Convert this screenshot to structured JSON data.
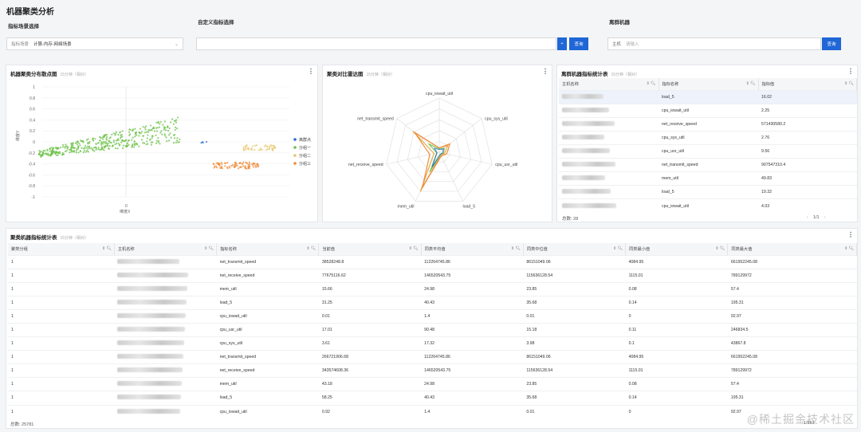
{
  "page": {
    "title": "机器聚类分析",
    "scene_label": "指标场景选择",
    "custom_label": "自定义指标选择",
    "discrete_label": "离群机器"
  },
  "scene_select": {
    "key": "指标场景",
    "value": "计算-内存-网络场景"
  },
  "custom": {
    "plus": "+",
    "query": "查询"
  },
  "host_filter": {
    "key": "主机",
    "placeholder": "请输入",
    "query": "查询"
  },
  "scatter": {
    "title": "机器聚类分布散点图",
    "sub": "15分钟（相对）",
    "ylabel": "维度Y",
    "xlabel": "维度X",
    "yticks": [
      "1",
      "0.8",
      "0.6",
      "0.4",
      "0.2",
      "0",
      "-0.2",
      "-0.4",
      "-0.6",
      "-0.8",
      "-1"
    ],
    "xtick": "0",
    "legend": [
      {
        "name": "离群点",
        "color": "#2c6bd0"
      },
      {
        "name": "分组一",
        "color": "#6dc24a"
      },
      {
        "name": "分组二",
        "color": "#e8c56a"
      },
      {
        "name": "分组三",
        "color": "#ef8c3a"
      }
    ]
  },
  "chart_data": {
    "type": "radar",
    "title": "聚类对比雷达图",
    "indicators": [
      "cpu_iowait_util",
      "cpu_sys_util",
      "cpu_usr_util",
      "load_5",
      "mem_util",
      "net_receive_speed",
      "net_transmit_speed"
    ]
  },
  "radar": {
    "title": "聚类对比雷达图",
    "sub": "15分钟（相对）"
  },
  "outlier": {
    "title": "离群机器指标统计表",
    "sub": "15分钟（相对）",
    "headers": [
      "主机名称",
      "指标名称",
      "指标值"
    ],
    "rows": [
      [
        "load_5",
        "16.02"
      ],
      [
        "cpu_iowait_util",
        "2.25"
      ],
      [
        "net_receive_speed",
        "571430580.2"
      ],
      [
        "cpu_sys_util",
        "2.76"
      ],
      [
        "cpu_usr_util",
        "9.56"
      ],
      [
        "net_transmit_speed",
        "907547310.4"
      ],
      [
        "mem_util",
        "49.83"
      ],
      [
        "load_5",
        "19.32"
      ],
      [
        "cpu_iowait_util",
        "4.03"
      ]
    ],
    "total": "总数:  28",
    "page": "1/1"
  },
  "cluster": {
    "title": "聚类机器指标统计表",
    "sub": "15分钟（相对）",
    "headers": [
      "聚类分组",
      "主机名称",
      "指标名称",
      "当前值",
      "同类平均值",
      "同类中位值",
      "同类最小值",
      "同类最大值"
    ],
    "rows": [
      [
        "1",
        "net_transmit_speed",
        "38528248.8",
        "112264745.86",
        "86151049.06",
        "4084.95",
        "661952245.08"
      ],
      [
        "1",
        "net_receive_speed",
        "77675116.62",
        "146520543.75",
        "115636128.54",
        "1115.01",
        "789129972"
      ],
      [
        "1",
        "mem_util",
        "15.66",
        "24.98",
        "23.85",
        "0.08",
        "57.4"
      ],
      [
        "1",
        "load_5",
        "31.25",
        "40.43",
        "35.68",
        "0.14",
        "195.31"
      ],
      [
        "1",
        "cpu_iowait_util",
        "0.01",
        "1.4",
        "0.01",
        "0",
        "92.97"
      ],
      [
        "1",
        "cpu_usr_util",
        "17.01",
        "90.48",
        "15.18",
        "0.11",
        "246834.5"
      ],
      [
        "1",
        "cpu_sys_util",
        "3.61",
        "17.32",
        "3.98",
        "0.1",
        "43867.8"
      ],
      [
        "1",
        "net_transmit_speed",
        "266721906.68",
        "112264745.86",
        "86151049.06",
        "4084.95",
        "661952245.08"
      ],
      [
        "1",
        "net_receive_speed",
        "343574608.36",
        "146520543.75",
        "115636128.54",
        "1115.01",
        "789129972"
      ],
      [
        "1",
        "mem_util",
        "43.18",
        "24.98",
        "23.85",
        "0.08",
        "57.4"
      ],
      [
        "1",
        "load_5",
        "58.25",
        "40.43",
        "35.68",
        "0.14",
        "195.31"
      ],
      [
        "1",
        "cpu_iowait_util",
        "0.92",
        "1.4",
        "0.01",
        "0",
        "92.97"
      ]
    ],
    "total": "总数:  25781",
    "page": "1/861"
  },
  "watermark": "@稀土掘金技术社区"
}
